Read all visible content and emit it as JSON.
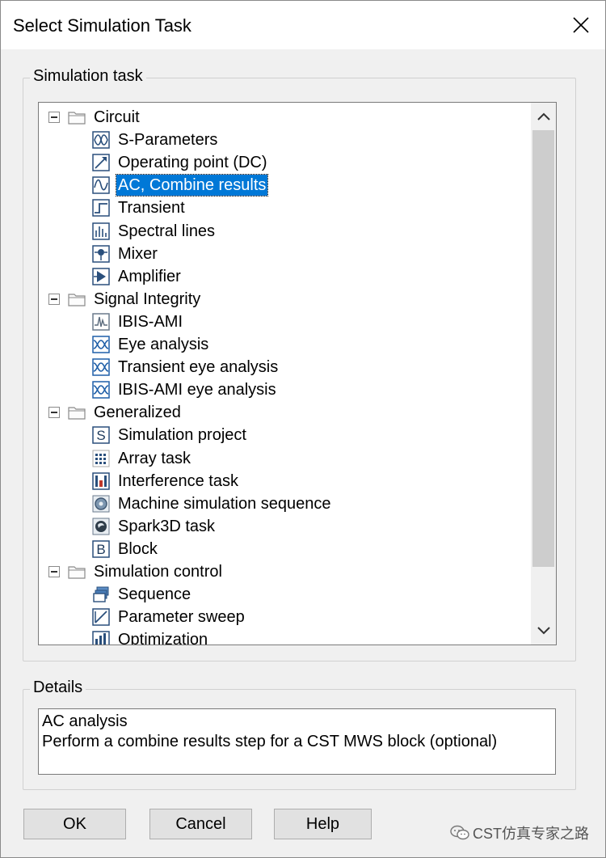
{
  "window": {
    "title": "Select Simulation Task"
  },
  "task_group": {
    "label": "Simulation task"
  },
  "tree": {
    "groups": [
      {
        "label": "Circuit",
        "items": [
          {
            "label": "S-Parameters",
            "icon": "sparam-icon"
          },
          {
            "label": "Operating point (DC)",
            "icon": "dc-icon"
          },
          {
            "label": "AC, Combine results",
            "icon": "ac-icon",
            "selected": true
          },
          {
            "label": "Transient",
            "icon": "transient-icon"
          },
          {
            "label": "Spectral lines",
            "icon": "spectral-icon"
          },
          {
            "label": "Mixer",
            "icon": "mixer-icon"
          },
          {
            "label": "Amplifier",
            "icon": "amplifier-icon"
          }
        ]
      },
      {
        "label": "Signal Integrity",
        "items": [
          {
            "label": "IBIS-AMI",
            "icon": "ibis-ami-icon"
          },
          {
            "label": "Eye analysis",
            "icon": "eye-icon"
          },
          {
            "label": "Transient eye analysis",
            "icon": "eye-icon"
          },
          {
            "label": "IBIS-AMI eye analysis",
            "icon": "eye-icon"
          }
        ]
      },
      {
        "label": "Generalized",
        "items": [
          {
            "label": "Simulation project",
            "icon": "s-letter-icon"
          },
          {
            "label": "Array task",
            "icon": "array-icon"
          },
          {
            "label": "Interference task",
            "icon": "interference-icon"
          },
          {
            "label": "Machine simulation sequence",
            "icon": "machine-icon"
          },
          {
            "label": "Spark3D task",
            "icon": "spark3d-icon"
          },
          {
            "label": "Block",
            "icon": "b-letter-icon"
          }
        ]
      },
      {
        "label": "Simulation control",
        "items": [
          {
            "label": "Sequence",
            "icon": "sequence-icon"
          },
          {
            "label": "Parameter sweep",
            "icon": "sweep-icon"
          },
          {
            "label": "Optimization",
            "icon": "optimization-icon"
          }
        ]
      }
    ]
  },
  "details": {
    "label": "Details",
    "line1": "AC analysis",
    "line2": "Perform a combine results step for a CST MWS block (optional)"
  },
  "buttons": {
    "ok": "OK",
    "cancel": "Cancel",
    "help": "Help"
  },
  "watermark": {
    "text": "CST仿真专家之路"
  },
  "colors": {
    "selection": "#0078d7",
    "dialog_bg": "#f0f0f0"
  }
}
